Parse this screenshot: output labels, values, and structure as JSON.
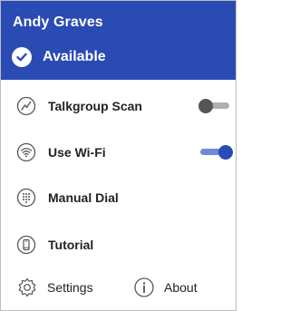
{
  "user": {
    "name": "Andy Graves"
  },
  "status": {
    "label": "Available"
  },
  "menu": [
    {
      "label": "Talkgroup Scan",
      "icon": "scan-icon",
      "toggle": "off"
    },
    {
      "label": "Use Wi-Fi",
      "icon": "wifi-icon",
      "toggle": "on"
    },
    {
      "label": "Manual Dial",
      "icon": "dialpad-icon"
    },
    {
      "label": "Tutorial",
      "icon": "phone-icon"
    }
  ],
  "footer": {
    "settings_label": "Settings",
    "about_label": "About"
  },
  "colors": {
    "header_bg": "#2a4bb3",
    "accent": "#2a4bb3"
  }
}
